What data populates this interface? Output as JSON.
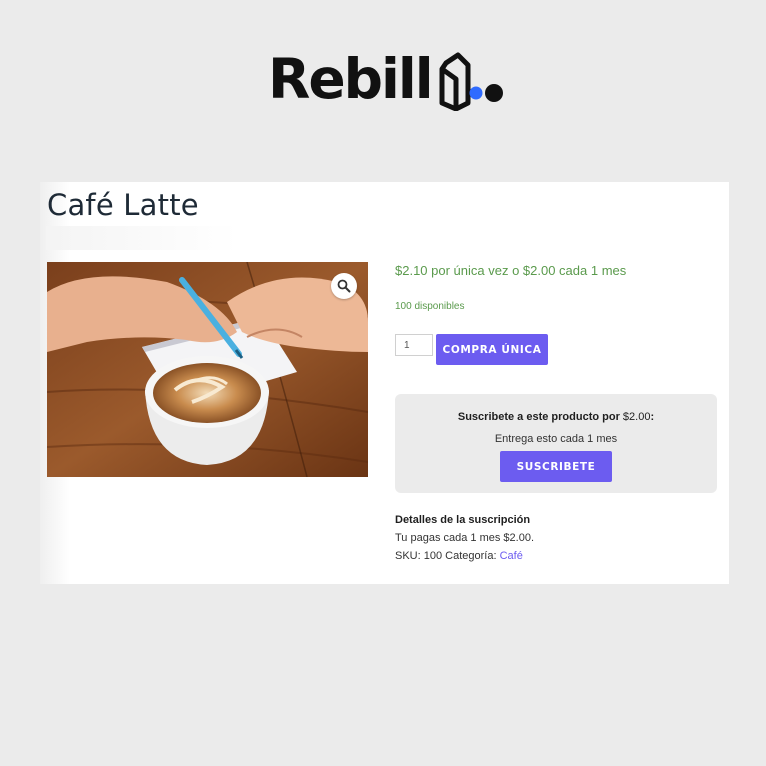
{
  "brand": {
    "name": "Rebill",
    "accent_color": "#2f6bff",
    "logo_icon": "rebill-box-mark"
  },
  "product": {
    "title": "Café Latte",
    "image": "coffee-latte-and-notebook-photo",
    "zoom_icon": "magnifier-icon",
    "price_text": "$2.10 por única vez o $2.00 cada 1 mes",
    "stock_text": "100 disponibles",
    "quantity_value": "1",
    "buy_once_label": "COMPRA ÚNICA"
  },
  "subscription": {
    "prompt_bold": "Suscribete a este producto por",
    "prompt_price": "$2.00",
    "prompt_suffix": ":",
    "delivery_text": "Entrega esto cada 1 mes",
    "subscribe_label": "SUSCRIBETE"
  },
  "details": {
    "title": "Detalles de la suscripción",
    "pay_text": "Tu pagas cada 1 mes $2.00.",
    "sku_label": "SKU:",
    "sku_value": "100",
    "category_label": "Categoría:",
    "category_value": "Café"
  },
  "colors": {
    "button": "#6c5cf0",
    "price_green": "#5a9a4c",
    "page_bg": "#ebebeb"
  }
}
